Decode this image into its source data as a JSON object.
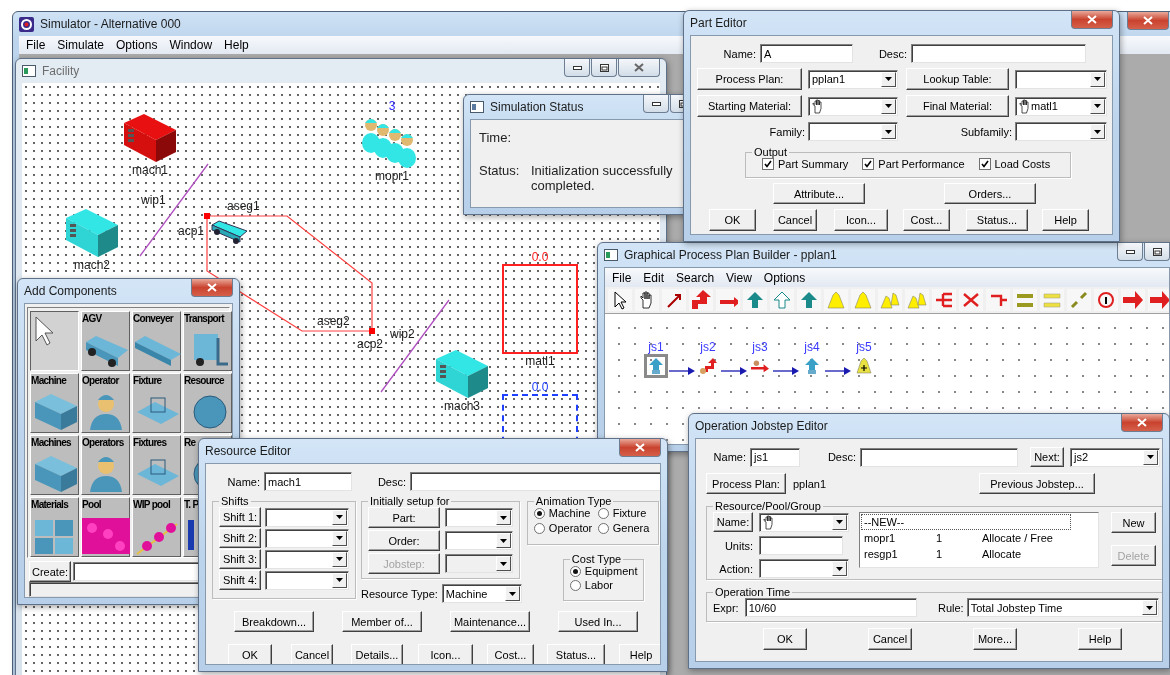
{
  "main_window": {
    "title": "Simulator - Alternative 000",
    "menu": [
      "File",
      "Simulate",
      "Options",
      "Window",
      "Help"
    ]
  },
  "facility": {
    "title": "Facility",
    "objects": [
      {
        "kind": "machine",
        "label": "mach1",
        "color": "#e81010"
      },
      {
        "kind": "operator",
        "label": "mopr1",
        "count": "3"
      },
      {
        "kind": "wip",
        "label": "wip1"
      },
      {
        "kind": "machine",
        "label": "mach2",
        "color": "#33e6e6"
      },
      {
        "kind": "wip",
        "label": "wip2"
      },
      {
        "kind": "machine",
        "label": "mach3",
        "color": "#33e6e6"
      },
      {
        "kind": "material",
        "label": "matl1",
        "reading": "0.0",
        "color": "#ff2020"
      },
      {
        "kind": "material",
        "reading": "0.0",
        "color": "#2040ff"
      }
    ],
    "path": {
      "segments": [
        "aseg1",
        "aseg2"
      ],
      "points": [
        "acp1",
        "acp2"
      ]
    }
  },
  "simulation_status": {
    "title": "Simulation Status",
    "time_label": "Time:",
    "status_label": "Status:",
    "status": "Initialization successfully completed."
  },
  "part_editor": {
    "title": "Part Editor",
    "name_label": "Name:",
    "name": "A",
    "desc_label": "Desc:",
    "process_plan": {
      "button": "Process Plan:",
      "value": "pplan1"
    },
    "lookup_table": {
      "button": "Lookup Table:"
    },
    "starting_material": {
      "button": "Starting Material:"
    },
    "final_material": {
      "button": "Final Material:",
      "value": "matl1"
    },
    "family_label": "Family:",
    "subfamily_label": "Subfamily:",
    "output": {
      "title": "Output",
      "options": [
        {
          "label": "Part Summary",
          "checked": true
        },
        {
          "label": "Part Performance",
          "checked": true
        },
        {
          "label": "Load Costs",
          "checked": true
        }
      ]
    },
    "buttons_top": [
      "Attribute...",
      "Orders..."
    ],
    "buttons": [
      "OK",
      "Cancel",
      "Icon...",
      "Cost...",
      "Status...",
      "Help"
    ]
  },
  "process_plan_builder": {
    "title": "Graphical Process Plan Builder - pplan1",
    "menu": [
      "File",
      "Edit",
      "Search",
      "View",
      "Options"
    ],
    "jobsteps": [
      {
        "label": "js1",
        "kind": "up",
        "selected": true
      },
      {
        "label": "js2",
        "kind": "turn",
        "selected": false
      },
      {
        "label": "js3",
        "kind": "move",
        "selected": false
      },
      {
        "label": "js4",
        "kind": "up",
        "selected": false
      },
      {
        "label": "js5",
        "kind": "bell",
        "selected": false
      }
    ]
  },
  "add_components": {
    "title": "Add Components",
    "tiles": [
      {
        "kind": "pointer",
        "selected": true
      },
      {
        "kind": "vehicle",
        "label": "AGV",
        "selected": false
      },
      {
        "kind": "conveyor",
        "label": "Conveyer",
        "selected": false
      },
      {
        "kind": "forklift",
        "label": "Transport",
        "selected": false
      },
      {
        "kind": "machine",
        "label": "Machine",
        "selected": false
      },
      {
        "kind": "person",
        "label": "Operator",
        "selected": false
      },
      {
        "kind": "fixture",
        "label": "Fixture",
        "selected": false
      },
      {
        "kind": "sphere",
        "label": "Resource",
        "selected": false
      },
      {
        "kind": "machine",
        "label": "Machines",
        "selected": false
      },
      {
        "kind": "person",
        "label": "Operators",
        "selected": false
      },
      {
        "kind": "fixture",
        "label": "Fixtures",
        "selected": false
      },
      {
        "kind": "sphere",
        "label": "Re",
        "selected": false
      },
      {
        "kind": "cubes",
        "label": "Materials",
        "selected": false
      },
      {
        "kind": "dots",
        "label": "Pool",
        "selected": false
      },
      {
        "kind": "beads",
        "label": "WIP pool",
        "selected": false
      },
      {
        "kind": "digit",
        "label": "T. P",
        "selected": false
      }
    ],
    "create_button": "Create:"
  },
  "resource_editor": {
    "title": "Resource Editor",
    "name_label": "Name:",
    "name": "mach1",
    "desc_label": "Desc:",
    "shifts": {
      "title": "Shifts",
      "items": [
        "Shift 1:",
        "Shift 2:",
        "Shift 3:",
        "Shift 4:"
      ]
    },
    "setup": {
      "title": "Initially setup for",
      "items": [
        {
          "label": "Part:",
          "disabled": false
        },
        {
          "label": "Order:",
          "disabled": false
        },
        {
          "label": "Jobstep:",
          "disabled": true
        }
      ]
    },
    "resource_type_label": "Resource Type:",
    "resource_type": "Machine",
    "animation_type": {
      "title": "Animation Type",
      "options": [
        {
          "label": "Machine",
          "selected": true
        },
        {
          "label": "Fixture",
          "selected": false
        },
        {
          "label": "Operator",
          "selected": false
        },
        {
          "label": "Genera",
          "selected": false
        }
      ]
    },
    "cost_type": {
      "title": "Cost Type",
      "options": [
        {
          "label": "Equipment",
          "selected": true
        },
        {
          "label": "Labor",
          "selected": false
        }
      ]
    },
    "buttons_top": [
      "Breakdown...",
      "Member of...",
      "Maintenance...",
      "Used In..."
    ],
    "buttons": [
      "OK",
      "Cancel",
      "Details...",
      "Icon...",
      "Cost...",
      "Status...",
      "Help"
    ]
  },
  "jobstep_editor": {
    "title": "Operation Jobstep Editor",
    "name_label": "Name:",
    "name": "js1",
    "desc_label": "Desc:",
    "next_button": "Next:",
    "next": "js2",
    "process_plan_button": "Process Plan:",
    "process_plan": "pplan1",
    "previous_button": "Previous Jobstep...",
    "resources": {
      "title": "Resource/Pool/Group",
      "name_button": "Name:",
      "units_label": "Units:",
      "action_label": "Action:",
      "rows": [
        {
          "cells": [
            "--NEW--"
          ],
          "selected": true
        },
        {
          "cells": [
            "mopr1",
            "1",
            "Allocate / Free"
          ],
          "selected": false
        },
        {
          "cells": [
            "resgp1",
            "1",
            "Allocate"
          ],
          "selected": false
        }
      ],
      "new_button": {
        "label": "New",
        "disabled": false
      },
      "delete_button": {
        "label": "Delete",
        "disabled": true
      }
    },
    "operation_time": {
      "title": "Operation Time",
      "expr_label": "Expr:",
      "expr": "10/60",
      "rule_label": "Rule:",
      "rule": "Total Jobstep Time"
    },
    "buttons": [
      "OK",
      "Cancel",
      "More...",
      "Help"
    ]
  }
}
